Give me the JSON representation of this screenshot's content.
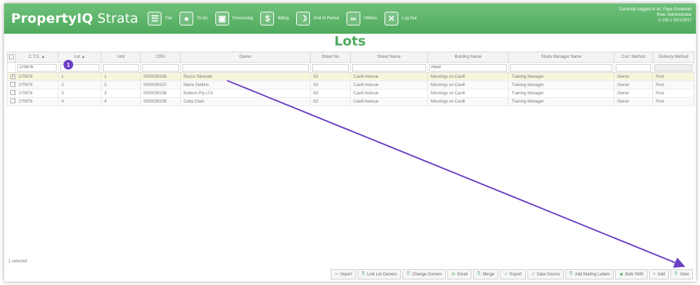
{
  "app": {
    "brand_bold": "PropertyIQ",
    "brand_rest": " Strata",
    "menu": [
      {
        "icon": "file-icon",
        "glyph": "☰",
        "label": "File"
      },
      {
        "icon": "speech-bubble-icon",
        "glyph": "●",
        "label": "To Do"
      },
      {
        "icon": "processing-icon",
        "glyph": "▣",
        "label": "Processing"
      },
      {
        "icon": "dollar-icon",
        "glyph": "$",
        "label": "Billing"
      },
      {
        "icon": "moon-icon",
        "glyph": "☽",
        "label": "End of Period"
      },
      {
        "icon": "link-icon",
        "glyph": "∞",
        "label": "Utilities"
      },
      {
        "icon": "close-icon",
        "glyph": "✕",
        "label": "Log Out"
      }
    ],
    "user_line": "Currently Logged In as: Faye Goodman",
    "role_line": "Role: Administrator",
    "version_line": "0.136.1 20/1/2017"
  },
  "page": {
    "title": "Lots"
  },
  "grid": {
    "headers": {
      "cts": "C.T.S. ▲",
      "lot": "Lot ▲",
      "unit": "Unit",
      "crn": "CRN",
      "owner": "Owner",
      "street_no": "Street No",
      "street_name": "Street Name",
      "building": "Building Name",
      "manager": "Strata Manager Name",
      "corr": "Corr. Method",
      "delivery": "Delivery Method"
    },
    "filters": {
      "cts": "270976",
      "lot": "",
      "unit": "",
      "crn": "",
      "owner": "",
      "street_no": "",
      "street_name": "",
      "building": "moor",
      "manager": "",
      "corr": "",
      "delivery": ""
    },
    "rows": [
      {
        "checked": "✓",
        "cts": "270976",
        "lot": "1",
        "unit": "1",
        "crn": "0000030336",
        "owner": "Rocco Silvester",
        "street_no": "63",
        "street_name": "Cavill Avenue",
        "building": "Moorings on Cavill",
        "manager": "Training Manager",
        "corr": "Owner",
        "delivery": "Post"
      },
      {
        "checked": "",
        "cts": "270976",
        "lot": "2",
        "unit": "2",
        "crn": "0000030337",
        "owner": "Maria Stellino",
        "street_no": "63",
        "street_name": "Cavill Avenue",
        "building": "Moorings on Cavill",
        "manager": "Training Manager",
        "corr": "Owner",
        "delivery": "Post"
      },
      {
        "checked": "",
        "cts": "270976",
        "lot": "3",
        "unit": "3",
        "crn": "0000030338",
        "owner": "Boltech Pty LTd",
        "street_no": "63",
        "street_name": "Cavill Avenue",
        "building": "Moorings on Cavill",
        "manager": "Training Manager",
        "corr": "Owner",
        "delivery": "Post"
      },
      {
        "checked": "",
        "cts": "270976",
        "lot": "4",
        "unit": "4",
        "crn": "0000030339",
        "owner": "Celia Chan",
        "street_no": "63",
        "street_name": "Cavill Avenue",
        "building": "Moorings on Cavill",
        "manager": "Training Manager",
        "corr": "Owner",
        "delivery": "Post"
      }
    ]
  },
  "annotation": {
    "badge": "1"
  },
  "status": {
    "text": "1 selected"
  },
  "toolbar": [
    {
      "icon": "import-icon",
      "glyph": "⇦",
      "label": "Import"
    },
    {
      "icon": "link-icon",
      "glyph": "⎘",
      "label": "Link Lot Owners"
    },
    {
      "icon": "users-icon",
      "glyph": "⎘",
      "label": "Change Owners"
    },
    {
      "icon": "email-icon",
      "glyph": "✉",
      "label": "Email"
    },
    {
      "icon": "merge-icon",
      "glyph": "⎘",
      "label": "Merge"
    },
    {
      "icon": "export-icon",
      "glyph": "↗",
      "label": "Export"
    },
    {
      "icon": "data-source-icon",
      "glyph": "↗",
      "label": "Data Source"
    },
    {
      "icon": "labels-icon",
      "glyph": "⎘",
      "label": "Add Mailing Labels"
    },
    {
      "icon": "sms-icon",
      "glyph": "◉",
      "label": "Bulk SMS"
    },
    {
      "icon": "add-icon",
      "glyph": "+",
      "label": "Add"
    },
    {
      "icon": "view-icon",
      "glyph": "⎘",
      "label": "View"
    }
  ],
  "colors": {
    "brand_green": "#4fab5d",
    "annotation_purple": "#6a3fc4"
  }
}
